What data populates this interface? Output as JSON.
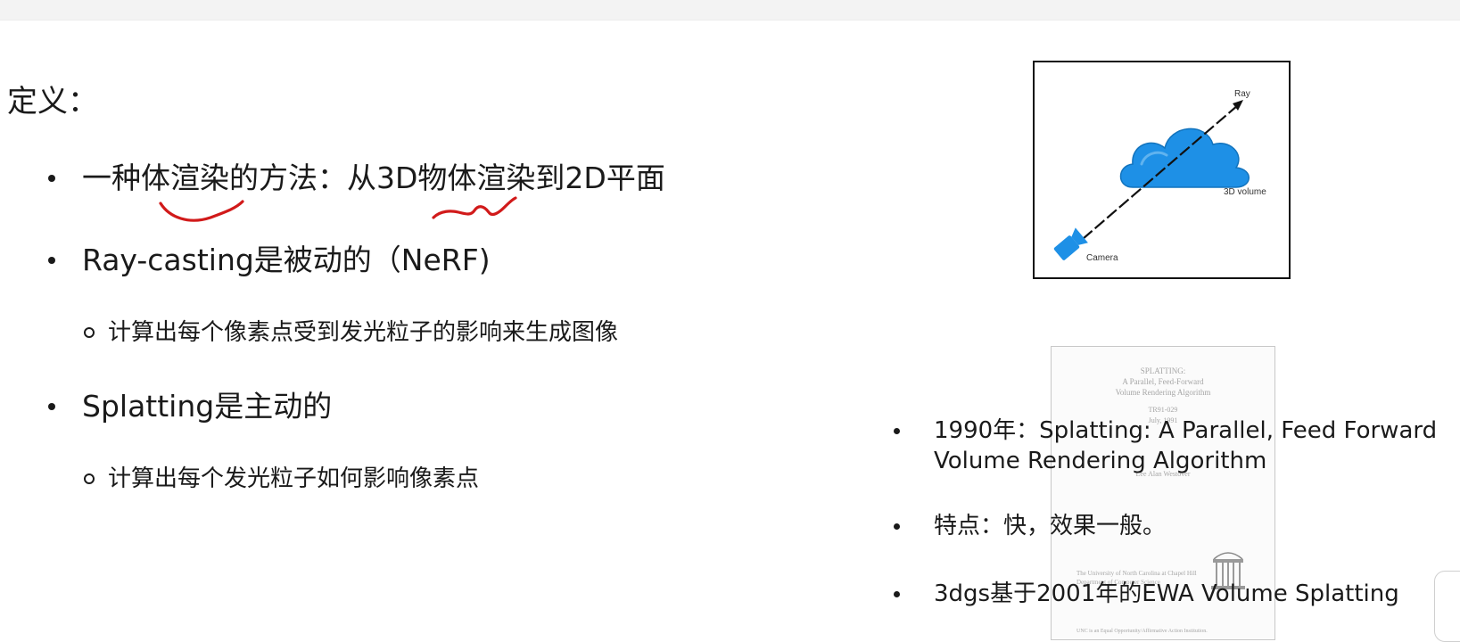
{
  "heading": "定义：",
  "left_bullets": [
    {
      "text": "一种体渲染的方法：从3D物体渲染到2D平面",
      "sub": []
    },
    {
      "text": "Ray-casting是被动的（NeRF)",
      "sub": [
        "计算出每个像素点受到发光粒子的影响来生成图像"
      ]
    },
    {
      "text": "Splatting是主动的",
      "sub": [
        "计算出每个发光粒子如何影响像素点"
      ]
    }
  ],
  "diagram": {
    "labels": {
      "ray": "Ray",
      "volume": "3D volume",
      "camera": "Camera"
    },
    "colors": {
      "cloud": "#1e90e6",
      "camera": "#1e90e6",
      "ray": "#111111"
    }
  },
  "paper_thumbnail": {
    "title_lines": [
      "SPLATTING:",
      "A Parallel, Feed-Forward",
      "Volume Rendering Algorithm"
    ],
    "meta_lines": [
      "TR91-029",
      "July, 1991"
    ],
    "author": "Lee Alan Westover",
    "institution_lines": [
      "The University of North Carolina at Chapel Hill",
      "Department of Computer Science"
    ],
    "footer": "UNC is an Equal Opportunity/Affirmative Action Institution."
  },
  "right_bullets": [
    {
      "lines": [
        "1990年：Splatting: A Parallel, Feed Forward",
        "Volume Rendering Algorithm"
      ]
    },
    {
      "lines": [
        "特点：快，效果一般。"
      ]
    },
    {
      "lines": [
        "3dgs基于2001年的EWA Volume Splatting"
      ]
    }
  ],
  "annotation": {
    "ink_color": "#d11a1a"
  }
}
